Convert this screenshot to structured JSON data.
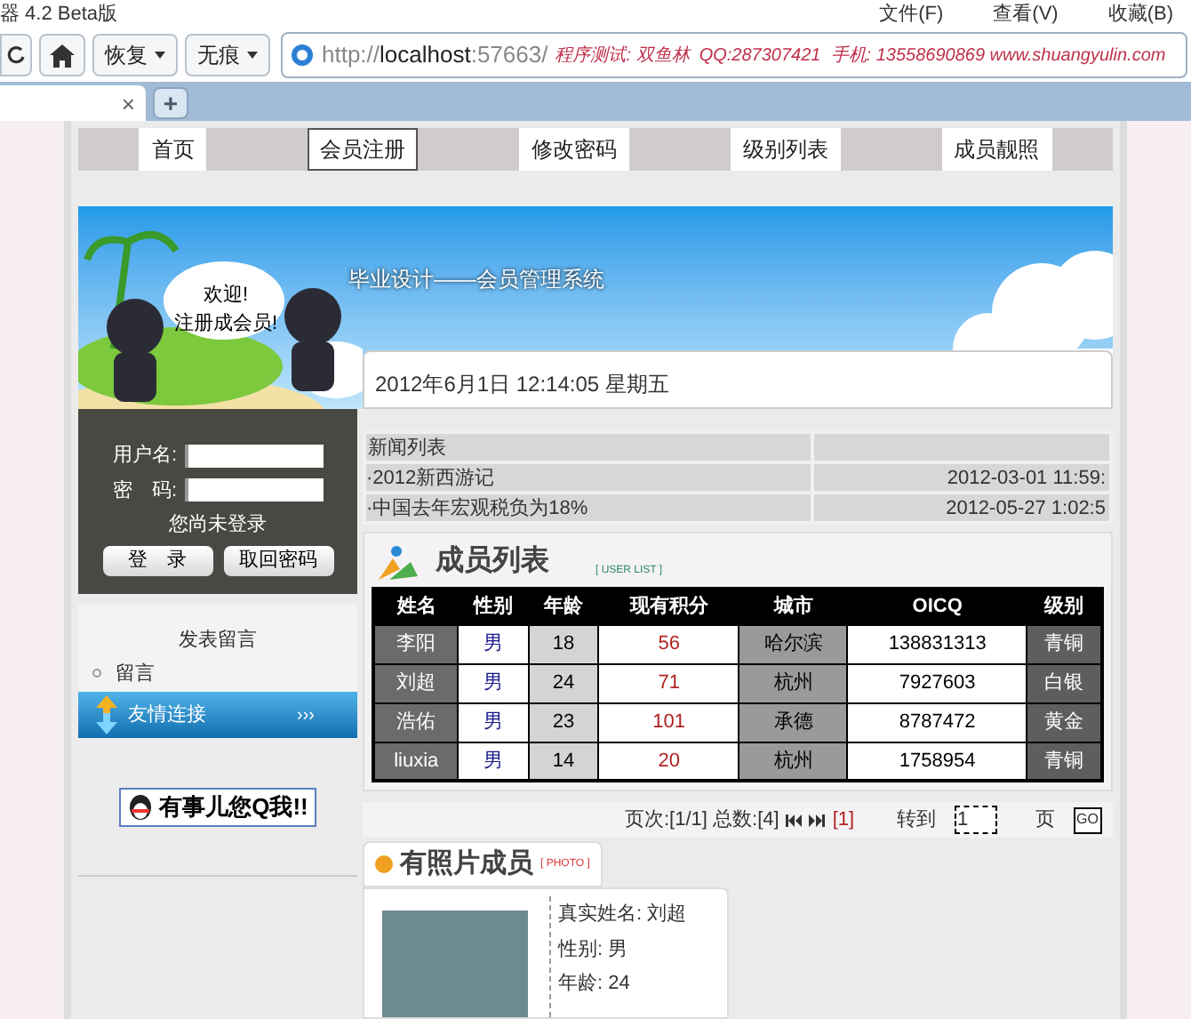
{
  "browser": {
    "title": "器 4.2 Beta版",
    "menu": [
      "文件(F)",
      "查看(V)",
      "收藏(B)"
    ],
    "toolbar": [
      {
        "kind": "refresh"
      },
      {
        "kind": "home"
      },
      {
        "kind": "dropdown",
        "label": "恢复"
      },
      {
        "kind": "dropdown",
        "label": "无痕"
      }
    ],
    "address": {
      "protocol": "http://",
      "host": "localhost",
      "port": ":57663/",
      "note": "程序测试: 双鱼林  QQ:287307421  手机: 13558690869 www.shuangyulin.com"
    },
    "tab_close": "×",
    "new_tab": "+"
  },
  "nav": [
    {
      "label": "首页",
      "selected": false
    },
    {
      "label": "会员注册",
      "selected": true
    },
    {
      "label": "修改密码",
      "selected": false
    },
    {
      "label": "级别列表",
      "selected": false
    },
    {
      "label": "成员靓照",
      "selected": false
    }
  ],
  "banner": {
    "title": "毕业设计——会员管理系统",
    "bubble": [
      "欢迎!",
      "注册成会员!"
    ]
  },
  "date": "2012年6月1日  12:14:05 星期五",
  "login": {
    "username_label": "用户名:",
    "password_label": "密　码:",
    "status": "您尚未登录",
    "buttons": [
      "登　录",
      "取回密码"
    ]
  },
  "sidebar": {
    "message_title": "发表留言",
    "links": [
      "留言"
    ],
    "friend_link": {
      "label": "友情连接",
      "arrows": "›››"
    },
    "qq_badge": "有事儿您Q我!!"
  },
  "news": {
    "heading": "新闻列表",
    "items": [
      {
        "title": "·2012新西游记",
        "time": "2012-03-01 11:59:"
      },
      {
        "title": "·中国去年宏观税负为18%",
        "time": "2012-05-27 1:02:5"
      }
    ]
  },
  "members": {
    "title": "成员列表",
    "subtitle": "[ USER LIST ]",
    "columns": [
      "姓名",
      "性别",
      "年龄",
      "现有积分",
      "城市",
      "OICQ",
      "级别"
    ],
    "rows": [
      [
        "李阳",
        "男",
        "18",
        "56",
        "哈尔滨",
        "138831313",
        "青铜"
      ],
      [
        "刘超",
        "男",
        "24",
        "71",
        "杭州",
        "7927603",
        "白银"
      ],
      [
        "浩佑",
        "男",
        "23",
        "101",
        "承德",
        "8787472",
        "黄金"
      ],
      [
        "liuxia",
        "男",
        "14",
        "20",
        "杭州",
        "1758954",
        "青铜"
      ]
    ]
  },
  "pagination": {
    "text": "页次:[1/1] 总数:[4]",
    "current": "[1]",
    "goto": "转到",
    "page_input": "1",
    "page": "页",
    "go": "GO"
  },
  "photo_members": {
    "title": "有照片成员",
    "subtitle": "[ PHOTO ]",
    "fields": [
      "真实姓名: 刘超",
      "性别: 男",
      "年龄: 24"
    ]
  }
}
